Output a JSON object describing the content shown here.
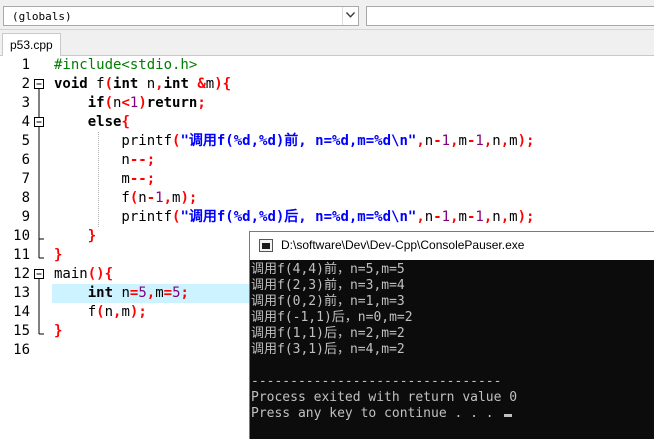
{
  "toolbar": {
    "scope_combo": "(globals)"
  },
  "tabs": [
    {
      "label": "p53.cpp"
    }
  ],
  "editor": {
    "line_numbers": [
      "1",
      "2",
      "3",
      "4",
      "5",
      "6",
      "7",
      "8",
      "9",
      "10",
      "11",
      "12",
      "13",
      "14",
      "15",
      "16"
    ],
    "highlighted_line": "13"
  },
  "console": {
    "title": "D:\\software\\Dev\\Dev-Cpp\\ConsolePauser.exe",
    "lines": [
      "调用f(4,4)前，n=5,m=5",
      "调用f(2,3)前，n=3,m=4",
      "调用f(0,2)前，n=1,m=3",
      "调用f(-1,1)后，n=0,m=2",
      "调用f(1,1)后，n=2,m=2",
      "调用f(3,1)后，n=4,m=2",
      "",
      "--------------------------------",
      "Process exited with return value 0",
      "Press any key to continue . . . "
    ]
  }
}
